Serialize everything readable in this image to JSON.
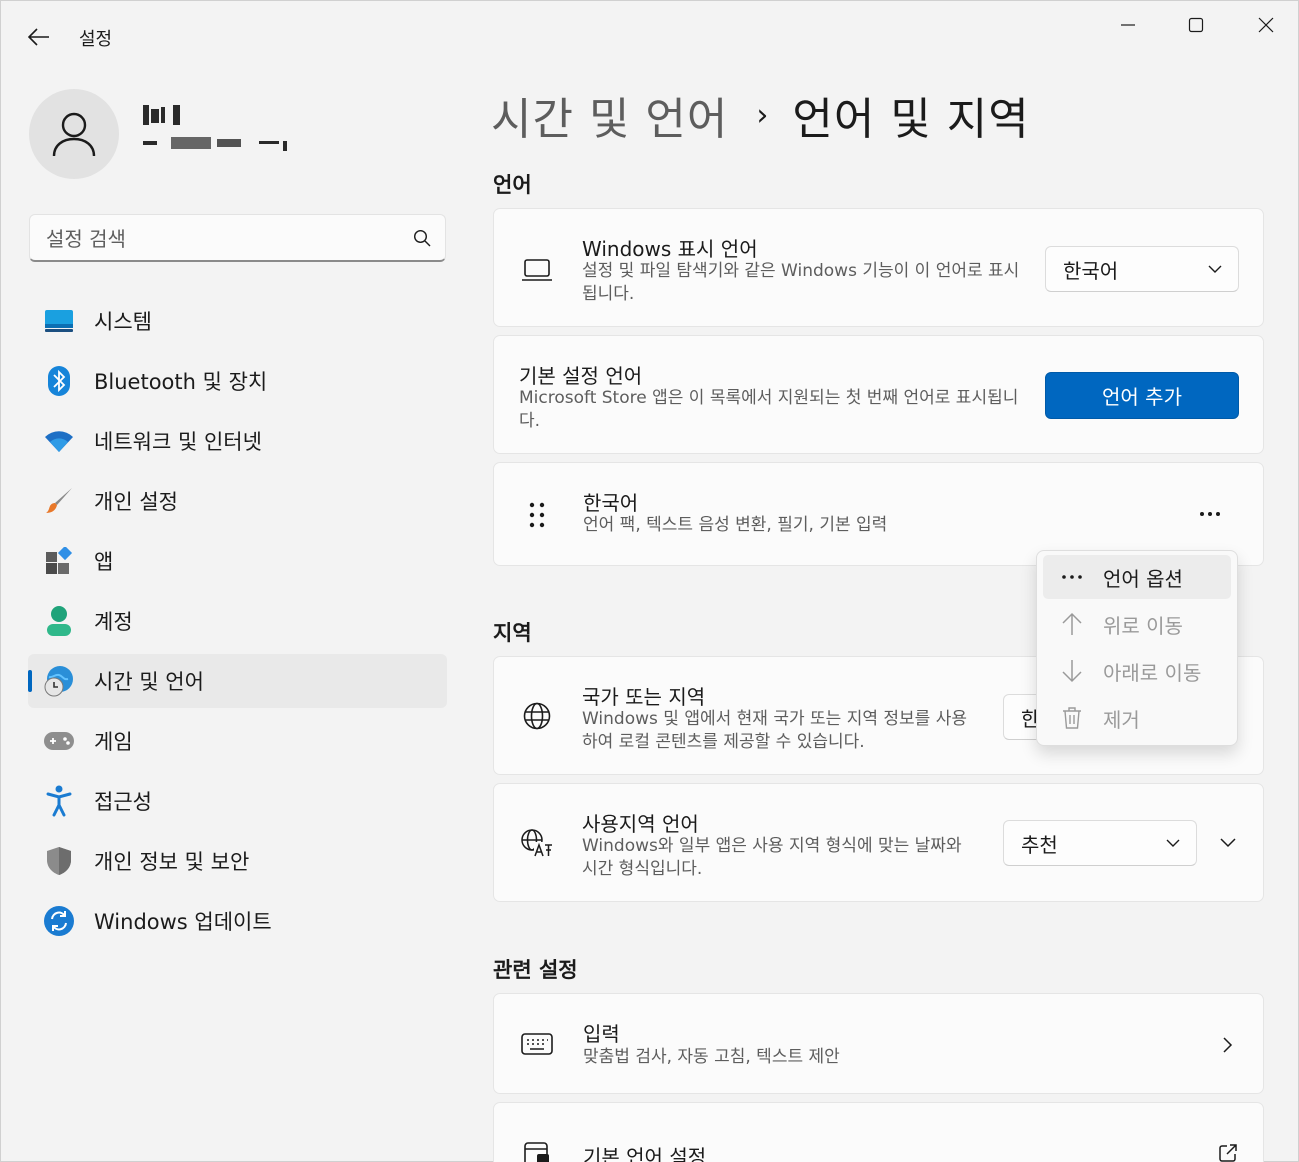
{
  "window": {
    "app_title": "설정"
  },
  "profile": {
    "name_redacted": "",
    "email_redacted": ""
  },
  "search": {
    "placeholder": "설정 검색"
  },
  "nav": {
    "items": [
      {
        "label": "시스템",
        "icon": "system-icon",
        "active": false
      },
      {
        "label": "Bluetooth 및 장치",
        "icon": "bluetooth-icon",
        "active": false
      },
      {
        "label": "네트워크 및 인터넷",
        "icon": "wifi-icon",
        "active": false
      },
      {
        "label": "개인 설정",
        "icon": "brush-icon",
        "active": false
      },
      {
        "label": "앱",
        "icon": "apps-icon",
        "active": false
      },
      {
        "label": "계정",
        "icon": "account-icon",
        "active": false
      },
      {
        "label": "시간 및 언어",
        "icon": "time-language-icon",
        "active": true
      },
      {
        "label": "게임",
        "icon": "gamepad-icon",
        "active": false
      },
      {
        "label": "접근성",
        "icon": "accessibility-icon",
        "active": false
      },
      {
        "label": "개인 정보 및 보안",
        "icon": "shield-icon",
        "active": false
      },
      {
        "label": "Windows 업데이트",
        "icon": "update-icon",
        "active": false
      }
    ]
  },
  "breadcrumb": {
    "parent": "시간 및 언어",
    "separator": "›",
    "current": "언어 및 지역"
  },
  "language_section": {
    "title": "언어",
    "display_language": {
      "title": "Windows 표시 언어",
      "desc": "설정 및 파일 탐색기와 같은 Windows 기능이 이 언어로 표시됩니다.",
      "value": "한국어"
    },
    "preferred_languages": {
      "title": "기본 설정 언어",
      "desc": "Microsoft Store 앱은 이 목록에서 지원되는 첫 번째 언어로 표시됩니다.",
      "button": "언어 추가"
    },
    "korean": {
      "title": "한국어",
      "desc": "언어 팩, 텍스트 음성 변환, 필기, 기본 입력",
      "more": "···"
    }
  },
  "context_menu": {
    "items": [
      {
        "label": "언어 옵션",
        "icon": "more-icon",
        "disabled": false
      },
      {
        "label": "위로 이동",
        "icon": "arrow-up-icon",
        "disabled": true
      },
      {
        "label": "아래로 이동",
        "icon": "arrow-down-icon",
        "disabled": true
      },
      {
        "label": "제거",
        "icon": "trash-icon",
        "disabled": true
      }
    ]
  },
  "region_section": {
    "title": "지역",
    "country": {
      "title": "국가 또는 지역",
      "desc": "Windows 및 앱에서 현재 국가 또는 지역 정보를 사용하여 로컬 콘텐츠를 제공할 수 있습니다.",
      "value": "한"
    },
    "regional_format": {
      "title": "사용지역 언어",
      "desc": "Windows와 일부 앱은 사용 지역 형식에 맞는 날짜와 시간 형식입니다.",
      "value": "추천"
    }
  },
  "related_section": {
    "title": "관련 설정",
    "typing": {
      "title": "입력",
      "desc": "맞춤법 검사, 자동 고침, 텍스트 제안"
    },
    "admin_language": {
      "title": "기본 언어 설정"
    }
  },
  "colors": {
    "accent": "#0067c0",
    "background": "#f3f3f3",
    "card": "#fbfbfb"
  }
}
